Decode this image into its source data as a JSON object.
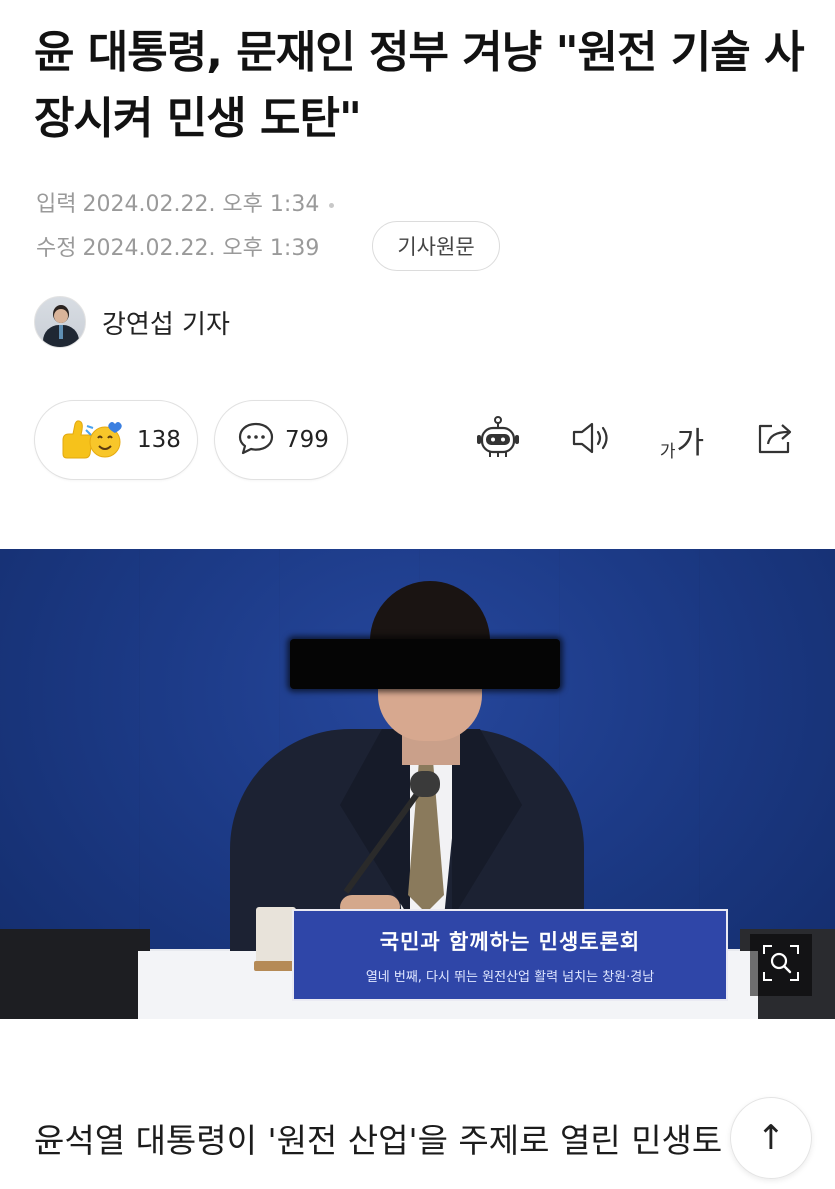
{
  "article": {
    "headline": "윤 대통령, 문재인 정부 겨냥 \"원전 기술 사장시켜 민생 도탄\"",
    "published_label": "입력",
    "published_at": "2024.02.22. 오후 1:34",
    "modified_label": "수정",
    "modified_at": "2024.02.22. 오후 1:39",
    "original_link_label": "기사원문",
    "reporter_name": "강연섭 기자",
    "body_first_line": "윤석열 대통령이 '원전 산업'을 주제로 열린 민생토"
  },
  "reactions": {
    "like_count": "138",
    "comment_count": "799"
  },
  "toolbar": {
    "font_small": "가",
    "font_big": "가",
    "icons": [
      "robot-summary-icon",
      "speaker-icon",
      "font-size-icon",
      "share-icon"
    ]
  },
  "photo": {
    "nameplate_line1": "국민과 함께하는 민생토론회",
    "nameplate_line2": "열네 번째, 다시 뛰는 원전산업 활력 넘치는 창원·경남"
  },
  "controls": {
    "scroll_top_glyph": "↑"
  },
  "colors": {
    "photo_background": "#1c3a86",
    "nameplate": "#2f46a8",
    "meta_text": "#9a9a9a"
  }
}
